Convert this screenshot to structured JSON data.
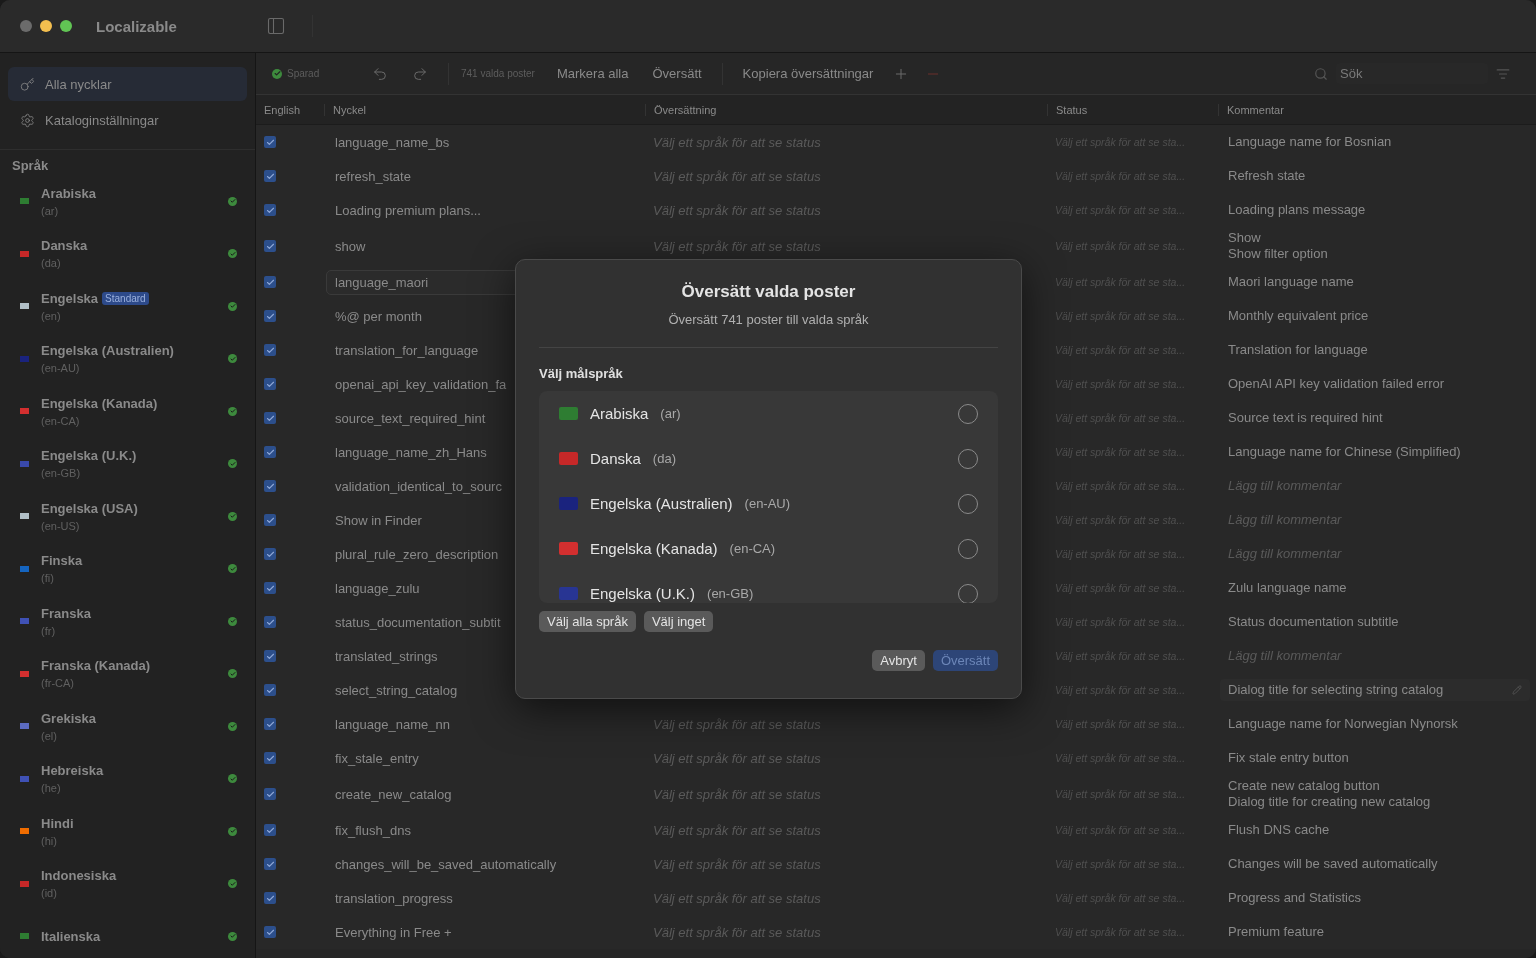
{
  "window": {
    "title": "Localizable"
  },
  "sidebar": {
    "nav": [
      {
        "label": "Alla nycklar",
        "selected": true
      },
      {
        "label": "Kataloginställningar",
        "selected": false
      }
    ],
    "section_title": "Språk",
    "languages": [
      {
        "name": "Arabiska",
        "code": "(ar)",
        "color": "#2e7d32",
        "complete": true
      },
      {
        "name": "Danska",
        "code": "(da)",
        "color": "#c62828",
        "complete": true
      },
      {
        "name": "Engelska",
        "code": "(en)",
        "badge": "Standard",
        "color": "#b0bec5",
        "complete": true
      },
      {
        "name": "Engelska (Australien)",
        "code": "(en-AU)",
        "color": "#1a237e",
        "complete": true
      },
      {
        "name": "Engelska (Kanada)",
        "code": "(en-CA)",
        "color": "#d32f2f",
        "complete": true
      },
      {
        "name": "Engelska (U.K.)",
        "code": "(en-GB)",
        "color": "#3949ab",
        "complete": true
      },
      {
        "name": "Engelska (USA)",
        "code": "(en-US)",
        "color": "#b0bec5",
        "complete": true
      },
      {
        "name": "Finska",
        "code": "(fi)",
        "color": "#1565c0",
        "complete": true
      },
      {
        "name": "Franska",
        "code": "(fr)",
        "color": "#3f51b5",
        "complete": true
      },
      {
        "name": "Franska (Kanada)",
        "code": "(fr-CA)",
        "color": "#d32f2f",
        "complete": true
      },
      {
        "name": "Grekiska",
        "code": "(el)",
        "color": "#5c6bc0",
        "complete": true
      },
      {
        "name": "Hebreiska",
        "code": "(he)",
        "color": "#3f51b5",
        "complete": true
      },
      {
        "name": "Hindi",
        "code": "(hi)",
        "color": "#ef6c00",
        "complete": true
      },
      {
        "name": "Indonesiska",
        "code": "(id)",
        "color": "#c62828",
        "complete": true
      },
      {
        "name": "Italienska",
        "color": "#2e7d32",
        "complete": true
      }
    ]
  },
  "toolbar": {
    "saved": "Sparad",
    "selection_count": "741 valda poster",
    "buttons": [
      "Markera alla",
      "Översätt"
    ],
    "copy_button": "Kopiera översättningar",
    "search": {
      "placeholder": "Sök"
    }
  },
  "table": {
    "columns": [
      "English",
      "Nyckel",
      "Översättning",
      "Status",
      "Kommentar"
    ],
    "rows": [
      {
        "checked": true,
        "selected": false,
        "key": "language_name_bs",
        "translation": "Välj ett språk för att se status",
        "status": "Välj ett språk för att se sta...",
        "comment": [
          "Language name for Bosnian"
        ],
        "kind": "text"
      },
      {
        "checked": true,
        "selected": false,
        "key": "refresh_state",
        "translation": "Välj ett språk för att se status",
        "status": "Välj ett språk för att se sta...",
        "comment": [
          "Refresh state"
        ],
        "kind": "text"
      },
      {
        "checked": true,
        "selected": false,
        "key": "Loading premium plans...",
        "translation": "Välj ett språk för att se status",
        "status": "Välj ett språk för att se sta...",
        "comment": [
          "Loading plans message"
        ],
        "kind": "text"
      },
      {
        "checked": true,
        "selected": false,
        "key": "show",
        "translation": "Välj ett språk för att se status",
        "status": "Välj ett språk för att se sta...",
        "comment": [
          "Show",
          "Show filter option"
        ],
        "kind": "text"
      },
      {
        "checked": true,
        "selected": true,
        "key": "language_maori",
        "status": "Välj ett språk för att se sta...",
        "comment": [
          "Maori language name"
        ],
        "kind": "text"
      },
      {
        "checked": true,
        "selected": false,
        "key": "%@ per month",
        "status": "Välj ett språk för att se sta...",
        "comment": [
          "Monthly equivalent price"
        ],
        "kind": "text"
      },
      {
        "checked": true,
        "selected": false,
        "key": "translation_for_language",
        "status": "Välj ett språk för att se sta...",
        "comment": [
          "Translation for language"
        ],
        "kind": "text"
      },
      {
        "checked": true,
        "selected": false,
        "key": "openai_api_key_validation_fa",
        "status": "Välj ett språk för att se sta...",
        "comment": [
          "OpenAI API key validation failed error"
        ],
        "kind": "text"
      },
      {
        "checked": true,
        "selected": false,
        "key": "source_text_required_hint",
        "status": "Välj ett språk för att se sta...",
        "comment": [
          "Source text is required hint"
        ],
        "kind": "text"
      },
      {
        "checked": true,
        "selected": false,
        "key": "language_name_zh_Hans",
        "status": "Välj ett språk för att se sta...",
        "comment": [
          "Language name for Chinese (Simplified)"
        ],
        "kind": "text"
      },
      {
        "checked": true,
        "selected": false,
        "key": "validation_identical_to_sourc",
        "status": "Välj ett språk för att se sta...",
        "comment": [
          "Lägg till kommentar"
        ],
        "kind": "placeholder"
      },
      {
        "checked": true,
        "selected": false,
        "key": "Show in Finder",
        "status": "Välj ett språk för att se sta...",
        "comment": [
          "Lägg till kommentar"
        ],
        "kind": "placeholder"
      },
      {
        "checked": true,
        "selected": false,
        "key": "plural_rule_zero_description",
        "status": "Välj ett språk för att se sta...",
        "comment": [
          "Lägg till kommentar"
        ],
        "kind": "placeholder"
      },
      {
        "checked": true,
        "selected": false,
        "key": "language_zulu",
        "status": "Välj ett språk för att se sta...",
        "comment": [
          "Zulu language name"
        ],
        "kind": "text"
      },
      {
        "checked": true,
        "selected": false,
        "key": "status_documentation_subtit",
        "status": "Välj ett språk för att se sta...",
        "comment": [
          "Status documentation subtitle"
        ],
        "kind": "text"
      },
      {
        "checked": true,
        "selected": false,
        "key": "translated_strings",
        "status": "Välj ett språk för att se sta...",
        "comment": [
          "Lägg till kommentar"
        ],
        "kind": "placeholder"
      },
      {
        "checked": true,
        "selected": false,
        "key": "select_string_catalog",
        "status": "Välj ett språk för att se sta...",
        "comment": [
          "Dialog title for selecting string catalog"
        ],
        "kind": "editing"
      },
      {
        "checked": true,
        "selected": false,
        "key": "language_name_nn",
        "translation": "Välj ett språk för att se status",
        "status": "Välj ett språk för att se sta...",
        "comment": [
          "Language name for Norwegian Nynorsk"
        ],
        "kind": "text"
      },
      {
        "checked": true,
        "selected": false,
        "key": "fix_stale_entry",
        "translation": "Välj ett språk för att se status",
        "status": "Välj ett språk för att se sta...",
        "comment": [
          "Fix stale entry button"
        ],
        "kind": "text"
      },
      {
        "checked": true,
        "selected": false,
        "key": "create_new_catalog",
        "translation": "Välj ett språk för att se status",
        "status": "Välj ett språk för att se sta...",
        "comment": [
          "Create new catalog button",
          "Dialog title for creating new catalog"
        ],
        "kind": "text"
      },
      {
        "checked": true,
        "selected": false,
        "key": "fix_flush_dns",
        "translation": "Välj ett språk för att se status",
        "status": "Välj ett språk för att se sta...",
        "comment": [
          "Flush DNS cache"
        ],
        "kind": "text"
      },
      {
        "checked": true,
        "selected": false,
        "key": "changes_will_be_saved_automatically",
        "translation": "Välj ett språk för att se status",
        "status": "Välj ett språk för att se sta...",
        "comment": [
          "Changes will be saved automatically"
        ],
        "kind": "text"
      },
      {
        "checked": true,
        "selected": false,
        "key": "translation_progress",
        "translation": "Välj ett språk för att se status",
        "status": "Välj ett språk för att se sta...",
        "comment": [
          "Progress and Statistics"
        ],
        "kind": "text"
      },
      {
        "checked": true,
        "selected": false,
        "key": "Everything in Free +",
        "translation": "Välj ett språk för att se status",
        "status": "Välj ett språk för att se sta...",
        "comment": [
          "Premium feature"
        ],
        "kind": "text"
      }
    ]
  },
  "dialog": {
    "title": "Översätt valda poster",
    "subtitle": "Översätt 741 poster till valda språk",
    "section_title": "Välj målspråk",
    "languages": [
      {
        "name": "Arabiska",
        "code": "(ar)",
        "color": "#2e7d32",
        "selected": false
      },
      {
        "name": "Danska",
        "code": "(da)",
        "color": "#c62828",
        "selected": false
      },
      {
        "name": "Engelska (Australien)",
        "code": "(en-AU)",
        "color": "#1a237e",
        "selected": false
      },
      {
        "name": "Engelska (Kanada)",
        "code": "(en-CA)",
        "color": "#d32f2f",
        "selected": false
      },
      {
        "name": "Engelska (U.K.)",
        "code": "(en-GB)",
        "color": "#283593",
        "selected": false
      }
    ],
    "select_buttons": [
      "Välj alla språk",
      "Välj inget"
    ],
    "cancel": "Avbryt",
    "confirm": {
      "label": "Översätt",
      "disabled": true
    }
  }
}
